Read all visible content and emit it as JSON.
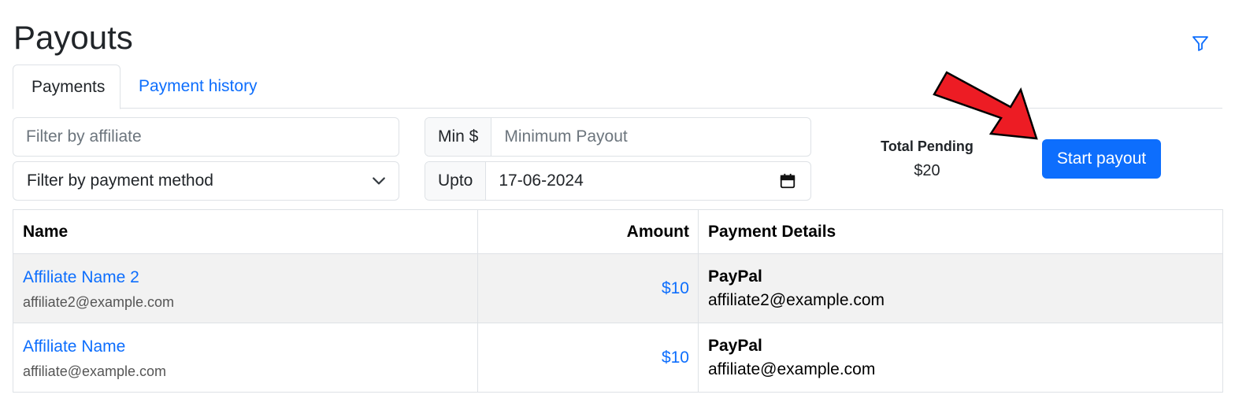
{
  "page": {
    "title": "Payouts"
  },
  "icons": {
    "filter": "filter-icon",
    "calendar": "calendar-icon",
    "chevron": "chevron-down-icon"
  },
  "colors": {
    "accent": "#0d6efd",
    "arrow": "#ed1c24"
  },
  "tabs": [
    {
      "label": "Payments",
      "active": true
    },
    {
      "label": "Payment history",
      "active": false
    }
  ],
  "filters": {
    "affiliate_placeholder": "Filter by affiliate",
    "payment_method_selected": "Filter by payment method",
    "min_label": "Min $",
    "min_placeholder": "Minimum Payout",
    "upto_label": "Upto",
    "upto_value": "17-06-2024"
  },
  "summary": {
    "label": "Total Pending",
    "value": "$20"
  },
  "actions": {
    "start_payout": "Start payout"
  },
  "table": {
    "headers": {
      "name": "Name",
      "amount": "Amount",
      "details": "Payment Details"
    },
    "rows": [
      {
        "name": "Affiliate Name 2",
        "email": "affiliate2@example.com",
        "amount": "$10",
        "method": "PayPal",
        "detail": "affiliate2@example.com"
      },
      {
        "name": "Affiliate Name",
        "email": "affiliate@example.com",
        "amount": "$10",
        "method": "PayPal",
        "detail": "affiliate@example.com"
      }
    ]
  }
}
